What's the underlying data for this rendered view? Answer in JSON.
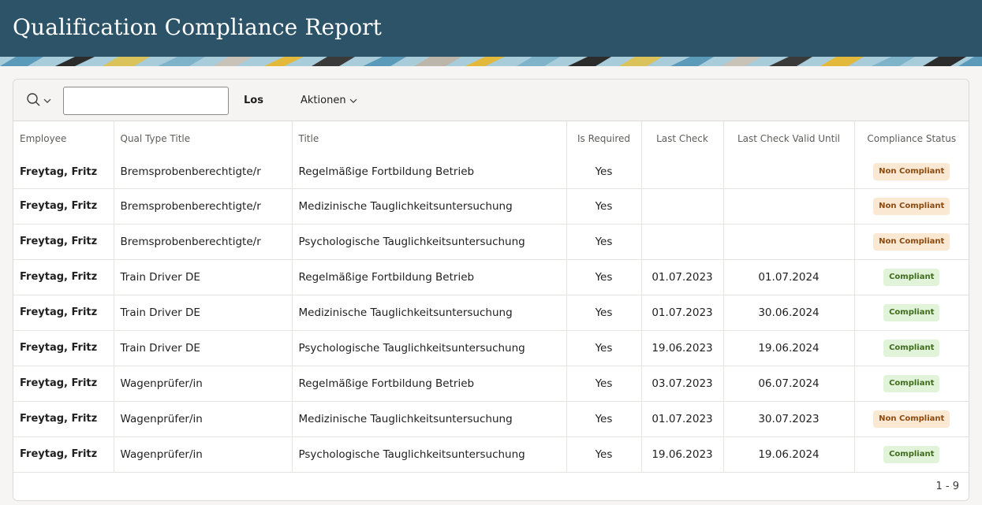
{
  "header": {
    "title": "Qualification Compliance Report"
  },
  "colors": {
    "header_bg": "#2c5368",
    "non_compliant_bg": "#fbe8d3",
    "compliant_bg": "#e1f3d8"
  },
  "toolbar": {
    "search_menu_icon": "search-icon",
    "search_value": "",
    "search_placeholder": "",
    "go_label": "Los",
    "actions_label": "Aktionen"
  },
  "table": {
    "columns": {
      "employee": "Employee",
      "qual_type_title": "Qual Type Title",
      "title": "Title",
      "is_required": "Is Required",
      "last_check": "Last Check",
      "last_check_valid_until": "Last Check Valid Until",
      "compliance_status": "Compliance Status"
    },
    "rows": [
      {
        "employee": "Freytag, Fritz",
        "qual_type_title": "Bremsprobenberechtigte/r",
        "title": "Regelmäßige Fortbildung Betrieb",
        "is_required": "Yes",
        "last_check": "",
        "last_check_valid_until": "",
        "compliance_status": "Non Compliant",
        "status_kind": "non"
      },
      {
        "employee": "Freytag, Fritz",
        "qual_type_title": "Bremsprobenberechtigte/r",
        "title": "Medizinische Tauglichkeitsuntersuchung",
        "is_required": "Yes",
        "last_check": "",
        "last_check_valid_until": "",
        "compliance_status": "Non Compliant",
        "status_kind": "non"
      },
      {
        "employee": "Freytag, Fritz",
        "qual_type_title": "Bremsprobenberechtigte/r",
        "title": "Psychologische Tauglichkeitsuntersuchung",
        "is_required": "Yes",
        "last_check": "",
        "last_check_valid_until": "",
        "compliance_status": "Non Compliant",
        "status_kind": "non"
      },
      {
        "employee": "Freytag, Fritz",
        "qual_type_title": "Train Driver DE",
        "title": "Regelmäßige Fortbildung Betrieb",
        "is_required": "Yes",
        "last_check": "01.07.2023",
        "last_check_valid_until": "01.07.2024",
        "compliance_status": "Compliant",
        "status_kind": "ok"
      },
      {
        "employee": "Freytag, Fritz",
        "qual_type_title": "Train Driver DE",
        "title": "Medizinische Tauglichkeitsuntersuchung",
        "is_required": "Yes",
        "last_check": "01.07.2023",
        "last_check_valid_until": "30.06.2024",
        "compliance_status": "Compliant",
        "status_kind": "ok"
      },
      {
        "employee": "Freytag, Fritz",
        "qual_type_title": "Train Driver DE",
        "title": "Psychologische Tauglichkeitsuntersuchung",
        "is_required": "Yes",
        "last_check": "19.06.2023",
        "last_check_valid_until": "19.06.2024",
        "compliance_status": "Compliant",
        "status_kind": "ok"
      },
      {
        "employee": "Freytag, Fritz",
        "qual_type_title": "Wagenprüfer/in",
        "title": "Regelmäßige Fortbildung Betrieb",
        "is_required": "Yes",
        "last_check": "03.07.2023",
        "last_check_valid_until": "06.07.2024",
        "compliance_status": "Compliant",
        "status_kind": "ok"
      },
      {
        "employee": "Freytag, Fritz",
        "qual_type_title": "Wagenprüfer/in",
        "title": "Medizinische Tauglichkeitsuntersuchung",
        "is_required": "Yes",
        "last_check": "01.07.2023",
        "last_check_valid_until": "30.07.2023",
        "compliance_status": "Non Compliant",
        "status_kind": "non"
      },
      {
        "employee": "Freytag, Fritz",
        "qual_type_title": "Wagenprüfer/in",
        "title": "Psychologische Tauglichkeitsuntersuchung",
        "is_required": "Yes",
        "last_check": "19.06.2023",
        "last_check_valid_until": "19.06.2024",
        "compliance_status": "Compliant",
        "status_kind": "ok"
      }
    ]
  },
  "pagination": {
    "label": "1 - 9"
  }
}
